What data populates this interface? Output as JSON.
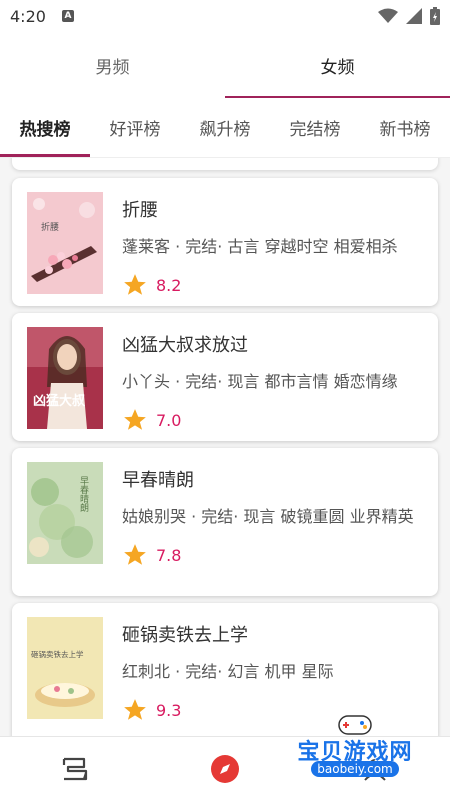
{
  "status_bar": {
    "time": "4:20"
  },
  "top_tabs": [
    {
      "label": "男频",
      "active": false
    },
    {
      "label": "女频",
      "active": true
    }
  ],
  "sub_tabs": [
    {
      "label": "热搜榜",
      "active": true
    },
    {
      "label": "好评榜",
      "active": false
    },
    {
      "label": "飙升榜",
      "active": false
    },
    {
      "label": "完结榜",
      "active": false
    },
    {
      "label": "新书榜",
      "active": false
    }
  ],
  "books": [
    {
      "title": "折腰",
      "meta": "蓬莱客 · 完结· 古言 穿越时空 相爱相杀",
      "score": "8.2",
      "cover_text": "折腰",
      "cover_color": "#f4c9cf"
    },
    {
      "title": "凶猛大叔求放过",
      "meta": "小丫头 · 完结· 现言 都市言情 婚恋情缘",
      "score": "7.0",
      "cover_text": "凶猛大叔",
      "cover_color": "#a8324a"
    },
    {
      "title": "早春晴朗",
      "meta": "姑娘别哭 · 完结· 现言 破镜重圆 业界精英",
      "score": "7.8",
      "cover_text": "早春晴朗",
      "cover_color": "#c9dcb9"
    },
    {
      "title": "砸锅卖铁去上学",
      "meta": "红刺北 · 完结· 幻言 机甲 星际",
      "score": "9.3",
      "cover_text": "砸锅卖铁去上学",
      "cover_color": "#f2e7b4"
    }
  ],
  "colors": {
    "accent": "#a0235a",
    "score": "#d81b60",
    "star": "#f5a623"
  },
  "bottom_nav": [
    {
      "icon": "bookshelf-icon"
    },
    {
      "icon": "compass-icon"
    },
    {
      "icon": "profile-icon"
    }
  ],
  "watermark": {
    "title": "宝贝游戏网",
    "url": "baobeiy.com"
  }
}
